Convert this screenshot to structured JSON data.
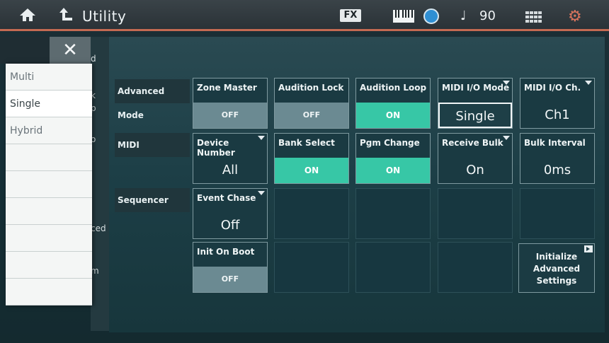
{
  "header": {
    "title": "Utility",
    "fx_label": "FX",
    "tempo": "90",
    "accent_color": "#c46a52"
  },
  "popup": {
    "close_label": "✕",
    "items": [
      "Multi",
      "Single",
      "Hybrid",
      "",
      "",
      "",
      "",
      "",
      ""
    ],
    "selected": "Single"
  },
  "fragments": [
    "d",
    "k",
    "p",
    "o",
    "ced",
    "m"
  ],
  "rows": [
    {
      "label": "Advanced Mode"
    },
    {
      "label": "MIDI"
    },
    {
      "label": "Sequencer"
    }
  ],
  "cells": {
    "zone_master": {
      "label": "Zone Master",
      "value": "OFF"
    },
    "audition_lock": {
      "label": "Audition Lock",
      "value": "OFF"
    },
    "audition_loop": {
      "label": "Audition Loop",
      "value": "ON"
    },
    "midi_io_mode": {
      "label": "MIDI I/O Mode",
      "value": "Single"
    },
    "midi_io_ch": {
      "label": "MIDI I/O Ch.",
      "value": "Ch1"
    },
    "device_number": {
      "label": "Device Number",
      "value": "All"
    },
    "bank_select": {
      "label": "Bank Select",
      "value": "ON"
    },
    "pgm_change": {
      "label": "Pgm Change",
      "value": "ON"
    },
    "receive_bulk": {
      "label": "Receive Bulk",
      "value": "On"
    },
    "bulk_interval": {
      "label": "Bulk Interval",
      "value": "0ms"
    },
    "event_chase": {
      "label": "Event Chase",
      "value": "Off"
    },
    "init_on_boot": {
      "label": "Init On Boot",
      "value": "OFF"
    }
  },
  "init_button": {
    "line1": "Initialize",
    "line2": "Advanced",
    "line3": "Settings"
  },
  "colors": {
    "on": "#37c7a6",
    "off": "#6b8a92"
  }
}
